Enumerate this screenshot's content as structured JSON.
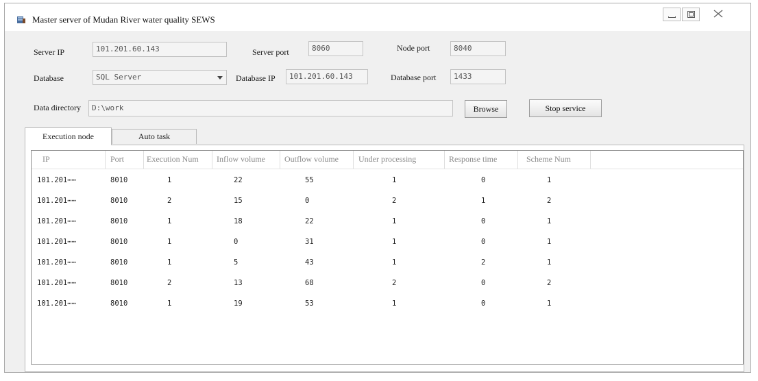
{
  "window": {
    "title": "Master server of Mudan River water quality SEWS",
    "icon": "database-server-icon"
  },
  "form": {
    "server_ip_label": "Server IP",
    "server_ip_value": "101.201.60.143",
    "server_port_label": "Server port",
    "server_port_value": "8060",
    "node_port_label": "Node port",
    "node_port_value": "8040",
    "database_label": "Database",
    "database_value": "SQL Server",
    "database_ip_label": "Database IP",
    "database_ip_value": "101.201.60.143",
    "database_port_label": "Database port",
    "database_port_value": "1433",
    "data_directory_label": "Data directory",
    "data_directory_value": "D:\\work",
    "browse_label": "Browse",
    "stop_service_label": "Stop service"
  },
  "tabs": [
    {
      "label": "Execution node"
    },
    {
      "label": "Auto task"
    }
  ],
  "table": {
    "headers": [
      "IP",
      "Port",
      "Execution Num",
      "Inflow volume",
      "Outflow volume",
      "Under processing",
      "Response time",
      "Scheme Num"
    ],
    "rows": [
      [
        "101.201⋯⋯",
        "8010",
        "1",
        "22",
        "55",
        "1",
        "0",
        "1"
      ],
      [
        "101.201⋯⋯",
        "8010",
        "2",
        "15",
        "0",
        "2",
        "1",
        "2"
      ],
      [
        "101.201⋯⋯",
        "8010",
        "1",
        "18",
        "22",
        "1",
        "0",
        "1"
      ],
      [
        "101.201⋯⋯",
        "8010",
        "1",
        "0",
        "31",
        "1",
        "0",
        "1"
      ],
      [
        "101.201⋯⋯",
        "8010",
        "1",
        "5",
        "43",
        "1",
        "2",
        "1"
      ],
      [
        "101.201⋯⋯",
        "8010",
        "2",
        "13",
        "68",
        "2",
        "0",
        "2"
      ],
      [
        "101.201⋯⋯",
        "8010",
        "1",
        "19",
        "53",
        "1",
        "0",
        "1"
      ]
    ]
  }
}
